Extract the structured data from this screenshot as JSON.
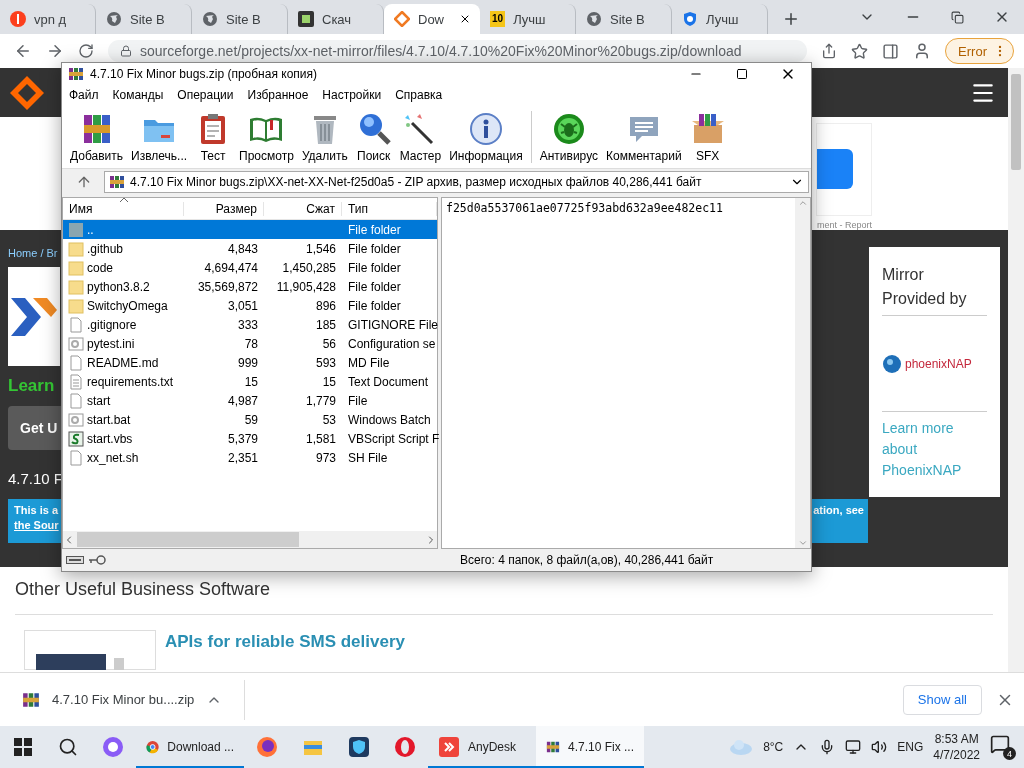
{
  "browser": {
    "tabs": [
      {
        "title": "vpn д",
        "kind": "yandex",
        "selected": false
      },
      {
        "title": "Site B",
        "kind": "globe",
        "selected": false
      },
      {
        "title": "Site B",
        "kind": "globe",
        "selected": false
      },
      {
        "title": "Скач",
        "kind": "s-square",
        "selected": false
      },
      {
        "title": "Dow",
        "kind": "diamond",
        "selected": true
      },
      {
        "title": "Лучш",
        "kind": "badge",
        "badge": "10",
        "selected": false
      },
      {
        "title": "Site B",
        "kind": "globe",
        "selected": false
      },
      {
        "title": "Лучш",
        "kind": "shield",
        "selected": false
      }
    ],
    "url": "sourceforge.net/projects/xx-net-mirror/files/4.7.10/4.7.10%20Fix%20Minor%20bugs.zip/download",
    "profile_button": "Error"
  },
  "page": {
    "ad_caption": "ment - Report",
    "breadcrumb": "Home / Br",
    "learn": "Learn",
    "get_button": "Get U",
    "version": "4.7.10 F",
    "notice": {
      "line_1": "This is a",
      "line_2": "the Sour",
      "line_1_end": "ation, see"
    },
    "mirror_card": {
      "heading": "Mirror Provided by",
      "logo_name": "phoenixNAP",
      "link": "Learn more about PhoenixNAP"
    },
    "section_title": "Other Useful Business Software",
    "product_title": "APIs for reliable SMS delivery"
  },
  "winrar": {
    "title": "4.7.10 Fix Minor bugs.zip (пробная копия)",
    "menu": [
      "Файл",
      "Команды",
      "Операции",
      "Избранное",
      "Настройки",
      "Справка"
    ],
    "toolbar_groups": [
      {
        "buttons": [
          {
            "label": "Добавить",
            "kind": "add"
          },
          {
            "label": "Извлечь...",
            "kind": "extract"
          },
          {
            "label": "Тест",
            "kind": "test"
          },
          {
            "label": "Просмотр",
            "kind": "view"
          },
          {
            "label": "Удалить",
            "kind": "delete"
          },
          {
            "label": "Поиск",
            "kind": "find"
          },
          {
            "label": "Мастер",
            "kind": "wizard"
          },
          {
            "label": "Информация",
            "kind": "info"
          }
        ]
      },
      {
        "buttons": [
          {
            "label": "Антивирус",
            "kind": "antivirus"
          },
          {
            "label": "Комментарий",
            "kind": "comment"
          },
          {
            "label": "SFX",
            "kind": "sfx"
          }
        ]
      }
    ],
    "path": "4.7.10 Fix Minor bugs.zip\\XX-net-XX-Net-f25d0a5 - ZIP архив, размер исходных файлов 40,286,441 байт",
    "columns": [
      "Имя",
      "Размер",
      "Сжат",
      "Тип"
    ],
    "files": [
      {
        "name": "..",
        "type": "File folder",
        "kind": "up",
        "selected": true
      },
      {
        "name": ".github",
        "size": "4,843",
        "packed": "1,546",
        "type": "File folder",
        "kind": "folder",
        "selected": false
      },
      {
        "name": "code",
        "size": "4,694,474",
        "packed": "1,450,285",
        "type": "File folder",
        "kind": "folder",
        "selected": false
      },
      {
        "name": "python3.8.2",
        "size": "35,569,872",
        "packed": "11,905,428",
        "type": "File folder",
        "kind": "folder",
        "selected": false
      },
      {
        "name": "SwitchyOmega",
        "size": "3,051",
        "packed": "896",
        "type": "File folder",
        "kind": "folder",
        "selected": false
      },
      {
        "name": ".gitignore",
        "size": "333",
        "packed": "185",
        "type": "GITIGNORE File",
        "kind": "file",
        "selected": false
      },
      {
        "name": "pytest.ini",
        "size": "78",
        "packed": "56",
        "type": "Configuration se",
        "kind": "config",
        "selected": false
      },
      {
        "name": "README.md",
        "size": "999",
        "packed": "593",
        "type": "MD File",
        "kind": "file",
        "selected": false
      },
      {
        "name": "requirements.txt",
        "size": "15",
        "packed": "15",
        "type": "Text Document",
        "kind": "text",
        "selected": false
      },
      {
        "name": "start",
        "size": "4,987",
        "packed": "1,779",
        "type": "File",
        "kind": "file",
        "selected": false
      },
      {
        "name": "start.bat",
        "size": "59",
        "packed": "53",
        "type": "Windows Batch",
        "kind": "config",
        "selected": false
      },
      {
        "name": "start.vbs",
        "size": "5,379",
        "packed": "1,581",
        "type": "VBScript Script F",
        "kind": "script",
        "selected": false
      },
      {
        "name": "xx_net.sh",
        "size": "2,351",
        "packed": "973",
        "type": "SH File",
        "kind": "file",
        "selected": false
      }
    ],
    "comment": "f25d0a5537061ae07725f93abd632a9ee482ec11",
    "status": "Всего: 4 папок, 8 файл(а,ов), 40,286,441 байт"
  },
  "download": {
    "file": "4.7.10 Fix Minor bu....zip",
    "show_all": "Show all"
  },
  "taskbar": {
    "items": [
      {
        "kind": "start",
        "running": false,
        "selected": false
      },
      {
        "kind": "search",
        "running": false,
        "selected": false
      },
      {
        "kind": "alice",
        "running": false,
        "selected": false
      },
      {
        "kind": "chrome",
        "label": "Download ...",
        "running": true,
        "selected": false
      },
      {
        "kind": "firefox",
        "running": false,
        "selected": false
      },
      {
        "kind": "explorer",
        "running": false,
        "selected": false
      },
      {
        "kind": "shield",
        "running": false,
        "selected": false
      },
      {
        "kind": "opera",
        "running": false,
        "selected": false
      },
      {
        "kind": "anydesk",
        "label": "AnyDesk",
        "running": true,
        "selected": false
      },
      {
        "kind": "winrar",
        "label": "4.7.10 Fix ...",
        "running": true,
        "selected": true
      }
    ],
    "weather": "8°C",
    "language": "ENG",
    "time": "8:53 AM",
    "date": "4/7/2022",
    "notifications": "4"
  }
}
